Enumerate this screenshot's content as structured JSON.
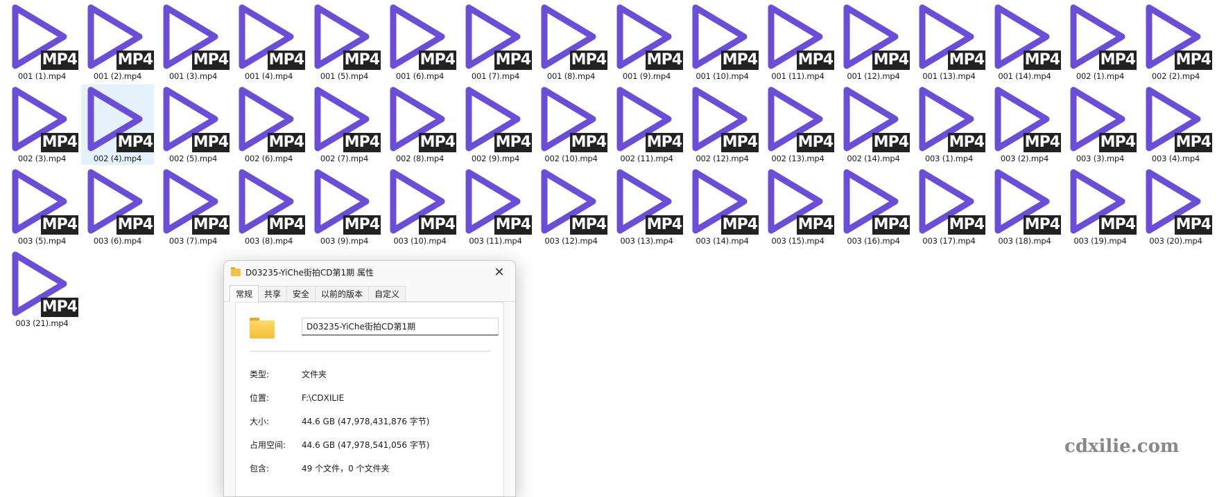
{
  "files": [
    "001 (1).mp4",
    "001 (2).mp4",
    "001 (3).mp4",
    "001 (4).mp4",
    "001 (5).mp4",
    "001 (6).mp4",
    "001 (7).mp4",
    "001 (8).mp4",
    "001 (9).mp4",
    "001 (10).mp4",
    "001 (11).mp4",
    "001 (12).mp4",
    "001 (13).mp4",
    "001 (14).mp4",
    "002 (1).mp4",
    "002 (2).mp4",
    "002 (3).mp4",
    "002 (4).mp4",
    "002 (5).mp4",
    "002 (6).mp4",
    "002 (7).mp4",
    "002 (8).mp4",
    "002 (9).mp4",
    "002 (10).mp4",
    "002 (11).mp4",
    "002 (12).mp4",
    "002 (13).mp4",
    "002 (14).mp4",
    "003 (1).mp4",
    "003 (2).mp4",
    "003 (3).mp4",
    "003 (4).mp4",
    "003 (5).mp4",
    "003 (6).mp4",
    "003 (7).mp4",
    "003 (8).mp4",
    "003 (9).mp4",
    "003 (10).mp4",
    "003 (11).mp4",
    "003 (12).mp4",
    "003 (13).mp4",
    "003 (14).mp4",
    "003 (15).mp4",
    "003 (16).mp4",
    "003 (17).mp4",
    "003 (18).mp4",
    "003 (19).mp4",
    "003 (20).mp4",
    "003 (21).mp4"
  ],
  "selected_file": "002 (4).mp4",
  "file_badge": "MP4",
  "file_icon": "play-triangle-icon",
  "colors": {
    "play_icon": "#6a4fd6",
    "badge_bg": "#222222",
    "selection": "#e5f1fb"
  },
  "dialog": {
    "title": "D03235-YiChe街拍CD第1期 属性",
    "tabs": [
      {
        "label": "常规",
        "active": true
      },
      {
        "label": "共享",
        "active": false
      },
      {
        "label": "安全",
        "active": false
      },
      {
        "label": "以前的版本",
        "active": false
      },
      {
        "label": "自定义",
        "active": false
      }
    ],
    "name_value": "D03235-YiChe街拍CD第1期",
    "properties": [
      {
        "label": "类型:",
        "value": "文件夹"
      },
      {
        "label": "位置:",
        "value": "F:\\CDXILIE"
      },
      {
        "label": "大小:",
        "value": "44.6 GB (47,978,431,876 字节)"
      },
      {
        "label": "占用空间:",
        "value": "44.6 GB (47,978,541,056 字节)"
      },
      {
        "label": "包含:",
        "value": "49 个文件，0 个文件夹"
      }
    ]
  },
  "watermark": "cdxilie.com"
}
